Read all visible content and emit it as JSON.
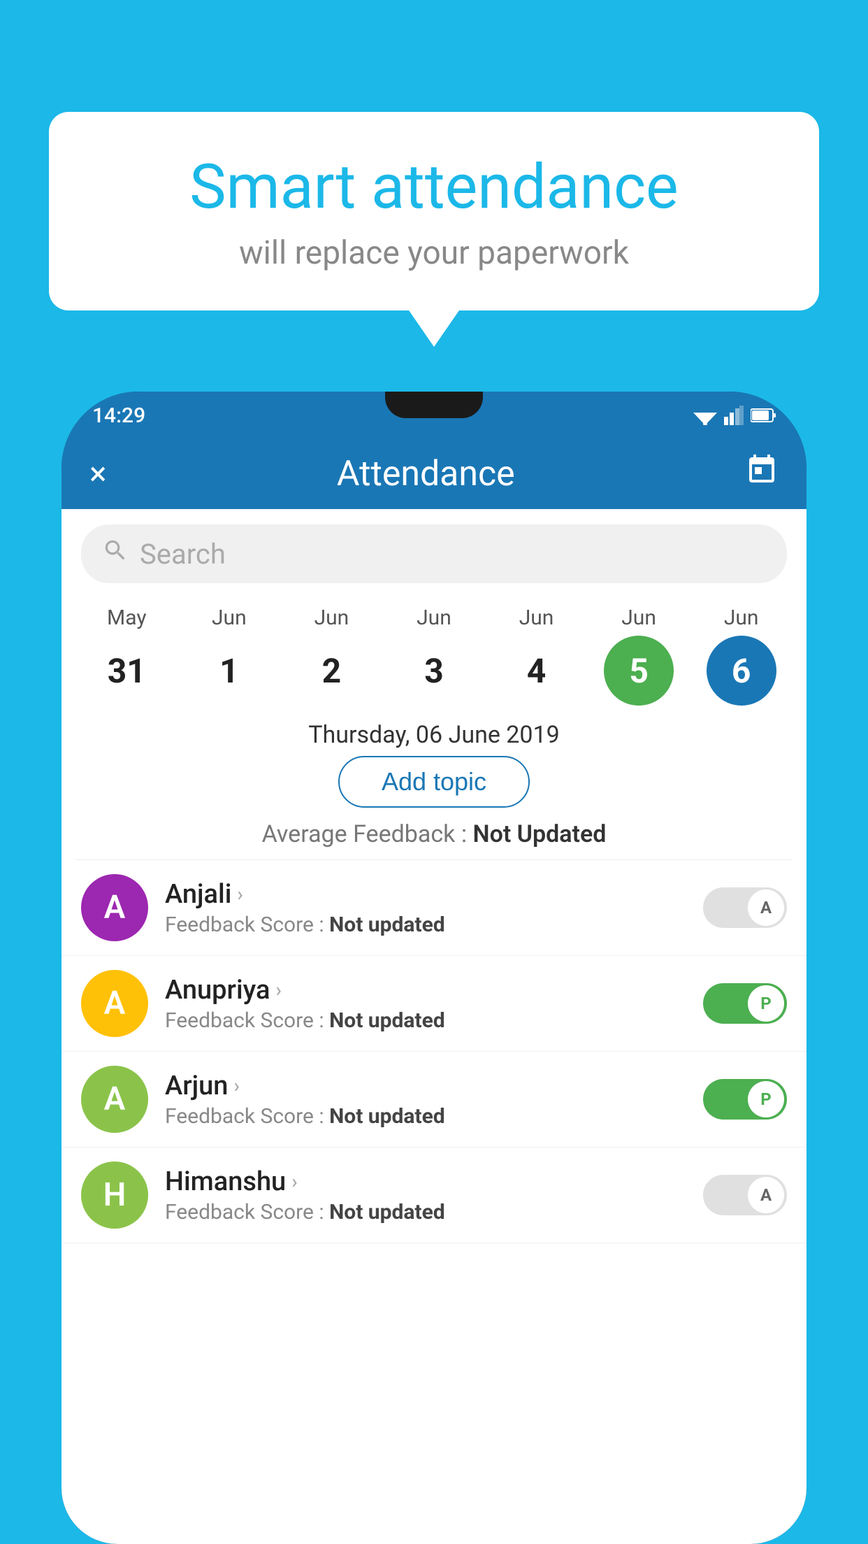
{
  "background_color": "#1bb8e8",
  "speech_bubble": {
    "title": "Smart attendance",
    "subtitle": "will replace your paperwork"
  },
  "status_bar": {
    "time": "14:29"
  },
  "app_bar": {
    "title": "Attendance",
    "close_label": "×",
    "calendar_label": "📅"
  },
  "search": {
    "placeholder": "Search"
  },
  "calendar": {
    "days": [
      {
        "month": "May",
        "date": "31",
        "state": "normal"
      },
      {
        "month": "Jun",
        "date": "1",
        "state": "normal"
      },
      {
        "month": "Jun",
        "date": "2",
        "state": "normal"
      },
      {
        "month": "Jun",
        "date": "3",
        "state": "normal"
      },
      {
        "month": "Jun",
        "date": "4",
        "state": "normal"
      },
      {
        "month": "Jun",
        "date": "5",
        "state": "today"
      },
      {
        "month": "Jun",
        "date": "6",
        "state": "selected"
      }
    ],
    "selected_date_label": "Thursday, 06 June 2019"
  },
  "add_topic_button": "Add topic",
  "average_feedback": {
    "label": "Average Feedback : ",
    "value": "Not Updated"
  },
  "students": [
    {
      "name": "Anjali",
      "avatar_letter": "A",
      "avatar_color": "#9c27b0",
      "feedback": "Feedback Score : ",
      "feedback_value": "Not updated",
      "toggle_state": "off",
      "toggle_letter": "A"
    },
    {
      "name": "Anupriya",
      "avatar_letter": "A",
      "avatar_color": "#ffc107",
      "feedback": "Feedback Score : ",
      "feedback_value": "Not updated",
      "toggle_state": "on",
      "toggle_letter": "P"
    },
    {
      "name": "Arjun",
      "avatar_letter": "A",
      "avatar_color": "#8bc34a",
      "feedback": "Feedback Score : ",
      "feedback_value": "Not updated",
      "toggle_state": "on",
      "toggle_letter": "P"
    },
    {
      "name": "Himanshu",
      "avatar_letter": "H",
      "avatar_color": "#8bc34a",
      "feedback": "Feedback Score : ",
      "feedback_value": "Not updated",
      "toggle_state": "off",
      "toggle_letter": "A"
    }
  ]
}
